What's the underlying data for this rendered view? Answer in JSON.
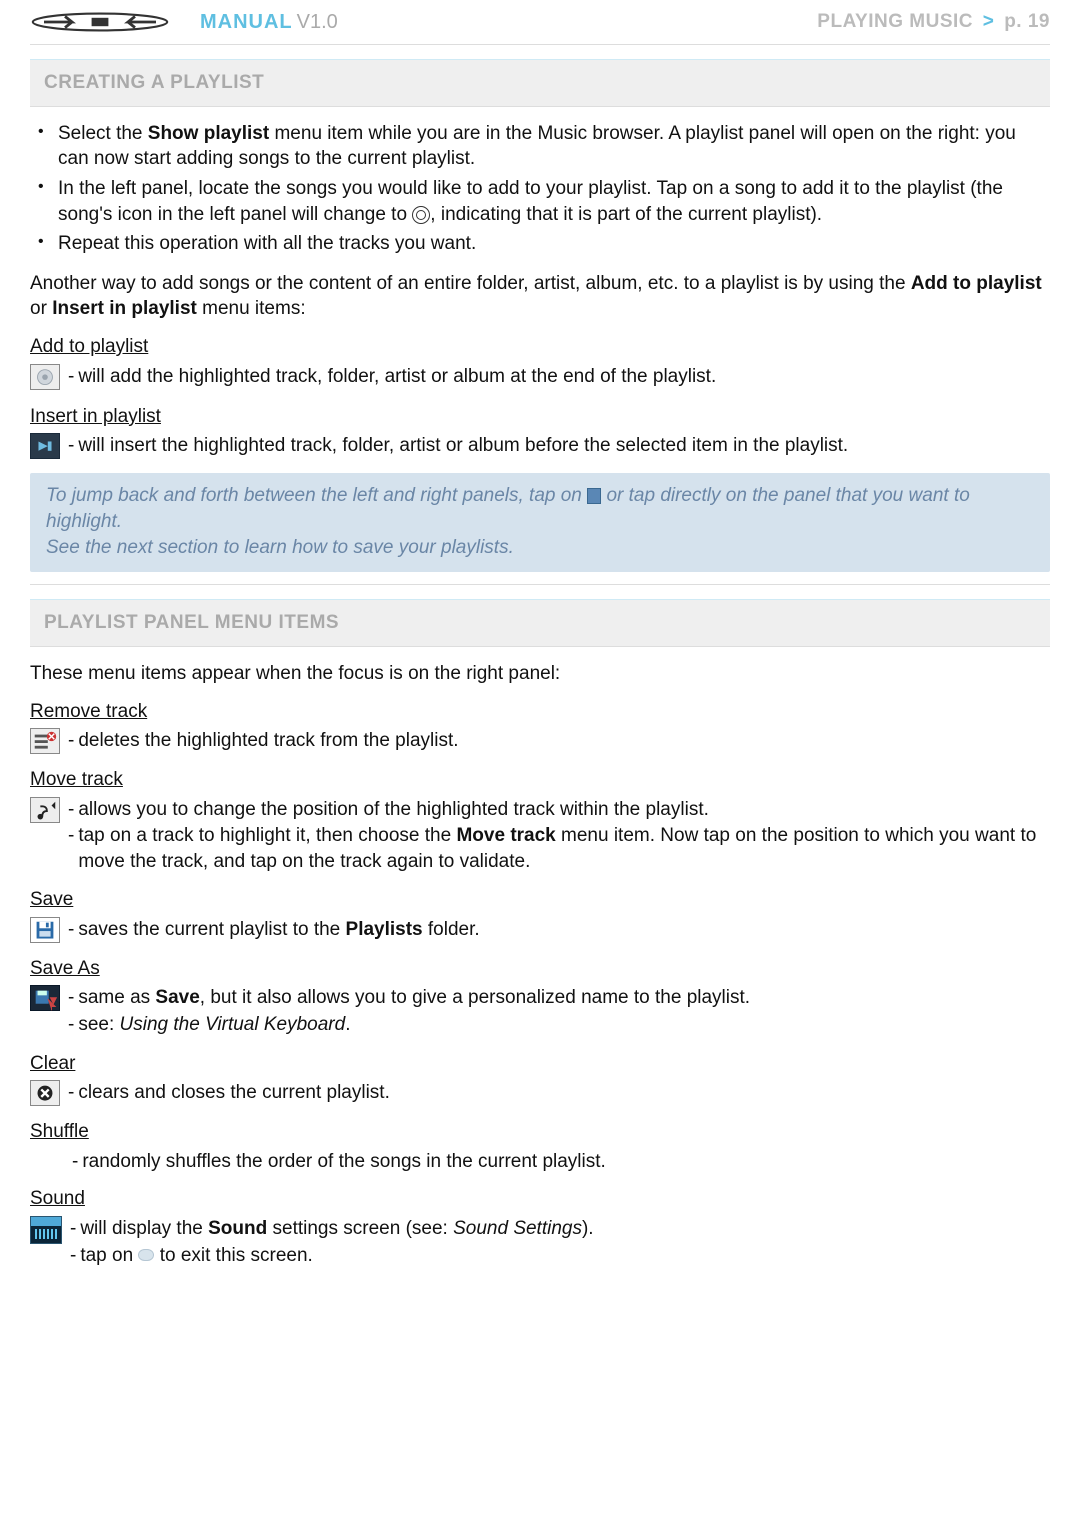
{
  "header": {
    "manual": "MANUAL",
    "version": "V1.0",
    "right_section": "PLAYING MUSIC",
    "right_page": "p. 19",
    "gt": ">"
  },
  "section1": {
    "title": "CREATING A PLAYLIST",
    "bullets": [
      "Select the <b>Show playlist</b> menu item while you are in the Music browser. A playlist panel will open on the right: you can now start adding songs to the current playlist.",
      "In the left panel, locate the songs you would like to add to your playlist. Tap on a song to add it to the playlist (the song's icon in the left panel will change to <CIRCLE>, indicating that it is part of the current playlist).",
      "Repeat this operation with all the tracks you want."
    ],
    "para1": "Another way to add songs or the content of an entire folder, artist, album, etc. to a playlist is by using the <b>Add to playlist</b> or <b>Insert in playlist</b> menu items:",
    "add_label": "Add to playlist",
    "add_desc": "will add the highlighted track, folder, artist or album at the end of the playlist.",
    "insert_label": "Insert in playlist",
    "insert_desc": "will insert the highlighted track, folder, artist or album before the selected item in the playlist.",
    "tip_line1_a": "To jump back and forth between the left and right panels, tap on ",
    "tip_line1_b": " or tap directly on the panel that you want to highlight.",
    "tip_line2": "See the next section to learn how to save your playlists."
  },
  "section2": {
    "title": "PLAYLIST PANEL MENU ITEMS",
    "intro": "These menu items appear when the focus is on the right panel:",
    "items": {
      "remove": {
        "label": "Remove track",
        "desc": "deletes the highlighted track from the playlist."
      },
      "move": {
        "label": "Move track",
        "desc1": "allows you to change the position of the highlighted track within the playlist.",
        "desc2": "tap on a track to highlight it, then choose the <b>Move track</b> menu item. Now tap on the position to which you want to move the track, and tap on the track again to validate."
      },
      "save": {
        "label": "Save",
        "desc": "saves the current playlist to the <b>Playlists</b> folder."
      },
      "saveas": {
        "label": "Save As",
        "desc1": "same as <b>Save</b>, but it also allows you to give a personalized name to the playlist.",
        "desc2": "see: <em>Using the Virtual Keyboard</em>."
      },
      "clear": {
        "label": "Clear",
        "desc": "clears and closes the current playlist."
      },
      "shuffle": {
        "label": "Shuffle",
        "desc": "randomly shuffles the order of the songs in the current playlist."
      },
      "sound": {
        "label": "Sound",
        "desc1": "will display the <b>Sound</b> settings screen (see: <em>Sound Settings</em>).",
        "desc2": "tap on <EYE> to exit this screen."
      }
    }
  }
}
